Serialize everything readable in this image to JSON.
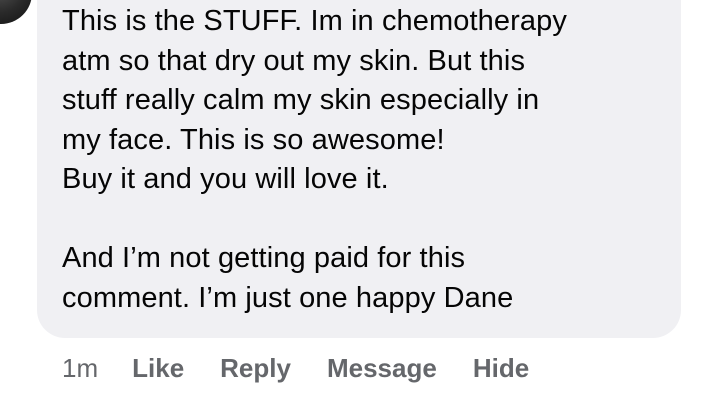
{
  "comment": {
    "lines": [
      "This is the STUFF. Im in chemotherapy",
      "atm so that dry out my skin. But this",
      "stuff really calm my skin especially in",
      "my face. This is so awesome!",
      "Buy it and you will love it.",
      "",
      "And I’m not getting paid for this",
      "comment. I’m just one happy Dane"
    ]
  },
  "actions": {
    "timestamp": "1m",
    "like": "Like",
    "reply": "Reply",
    "message": "Message",
    "hide": "Hide"
  },
  "colors": {
    "bubble": "#f0f0f3",
    "text": "#050505",
    "secondary": "#65676b"
  }
}
